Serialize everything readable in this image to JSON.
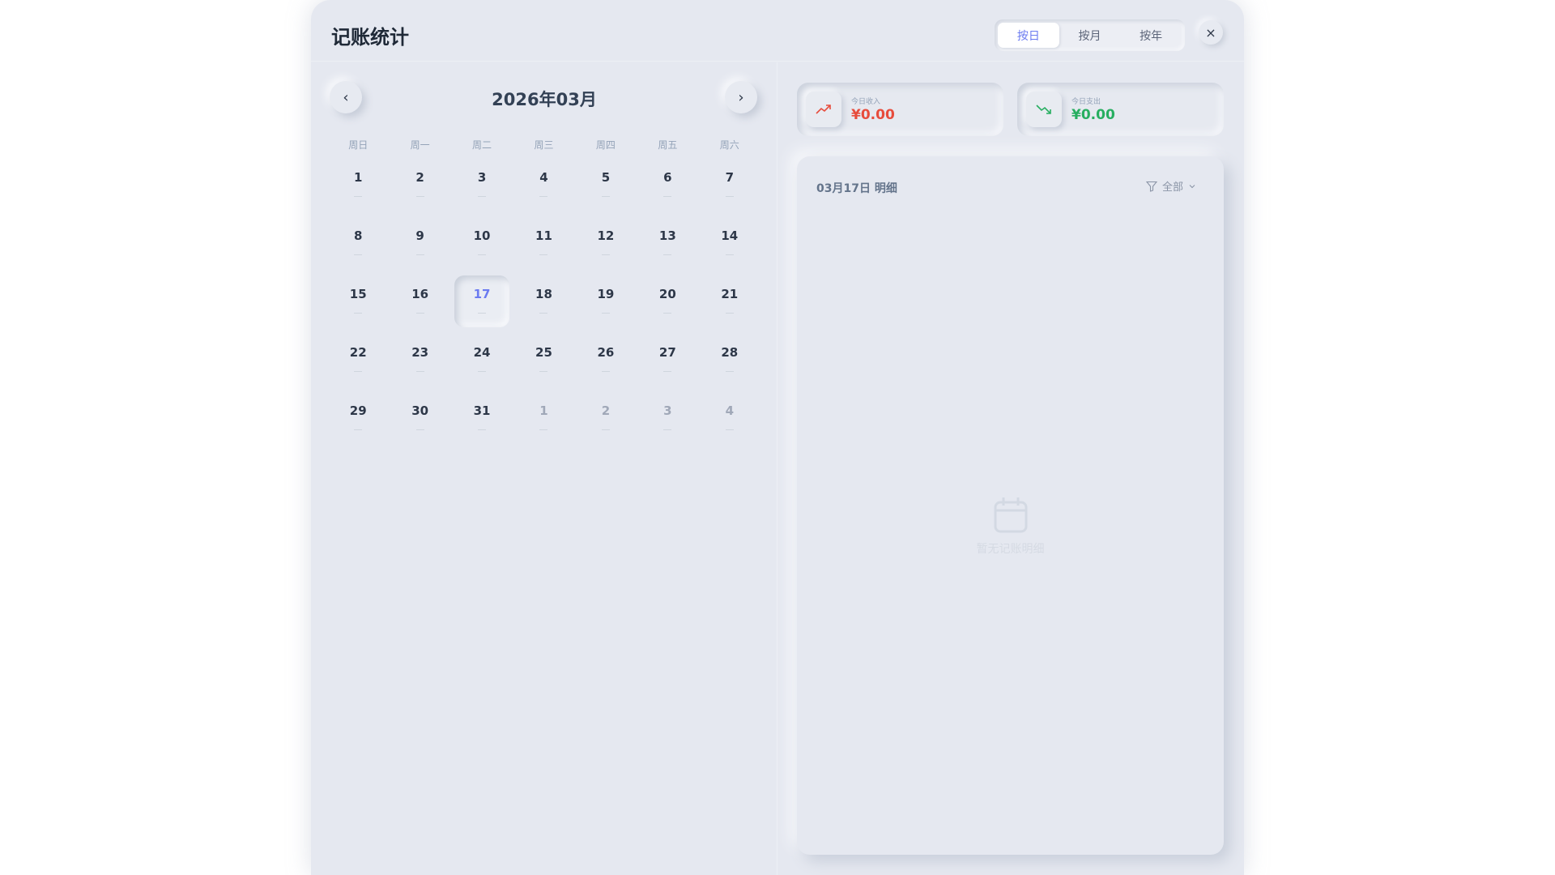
{
  "header": {
    "title": "记账统计",
    "tabs": [
      "按日",
      "按月",
      "按年"
    ],
    "active_tab": 0,
    "close_icon": "×"
  },
  "calendar": {
    "title": "2026年03月",
    "prev_icon": "‹",
    "next_icon": "›",
    "weekdays": [
      "周日",
      "周一",
      "周二",
      "周三",
      "周四",
      "周五",
      "周六"
    ],
    "days": [
      {
        "n": "1"
      },
      {
        "n": "2"
      },
      {
        "n": "3"
      },
      {
        "n": "4"
      },
      {
        "n": "5"
      },
      {
        "n": "6"
      },
      {
        "n": "7"
      },
      {
        "n": "8"
      },
      {
        "n": "9"
      },
      {
        "n": "10"
      },
      {
        "n": "11"
      },
      {
        "n": "12"
      },
      {
        "n": "13"
      },
      {
        "n": "14"
      },
      {
        "n": "15"
      },
      {
        "n": "16"
      },
      {
        "n": "17",
        "selected": true
      },
      {
        "n": "18"
      },
      {
        "n": "19"
      },
      {
        "n": "20"
      },
      {
        "n": "21"
      },
      {
        "n": "22"
      },
      {
        "n": "23"
      },
      {
        "n": "24"
      },
      {
        "n": "25"
      },
      {
        "n": "26"
      },
      {
        "n": "27"
      },
      {
        "n": "28"
      },
      {
        "n": "29"
      },
      {
        "n": "30"
      },
      {
        "n": "31"
      },
      {
        "n": "1",
        "other": true
      },
      {
        "n": "2",
        "other": true
      },
      {
        "n": "3",
        "other": true
      },
      {
        "n": "4",
        "other": true
      }
    ],
    "amount_placeholder": "—"
  },
  "summary": {
    "income": {
      "label": "今日收入",
      "value": "¥0.00",
      "color": "#e74c3c",
      "icon": "trending-up"
    },
    "expense": {
      "label": "今日支出",
      "value": "¥0.00",
      "color": "#27ae60",
      "icon": "trending-down"
    }
  },
  "detail": {
    "title": "03月17日 明细",
    "filter": "全部",
    "empty_text": "暂无记账明细"
  }
}
